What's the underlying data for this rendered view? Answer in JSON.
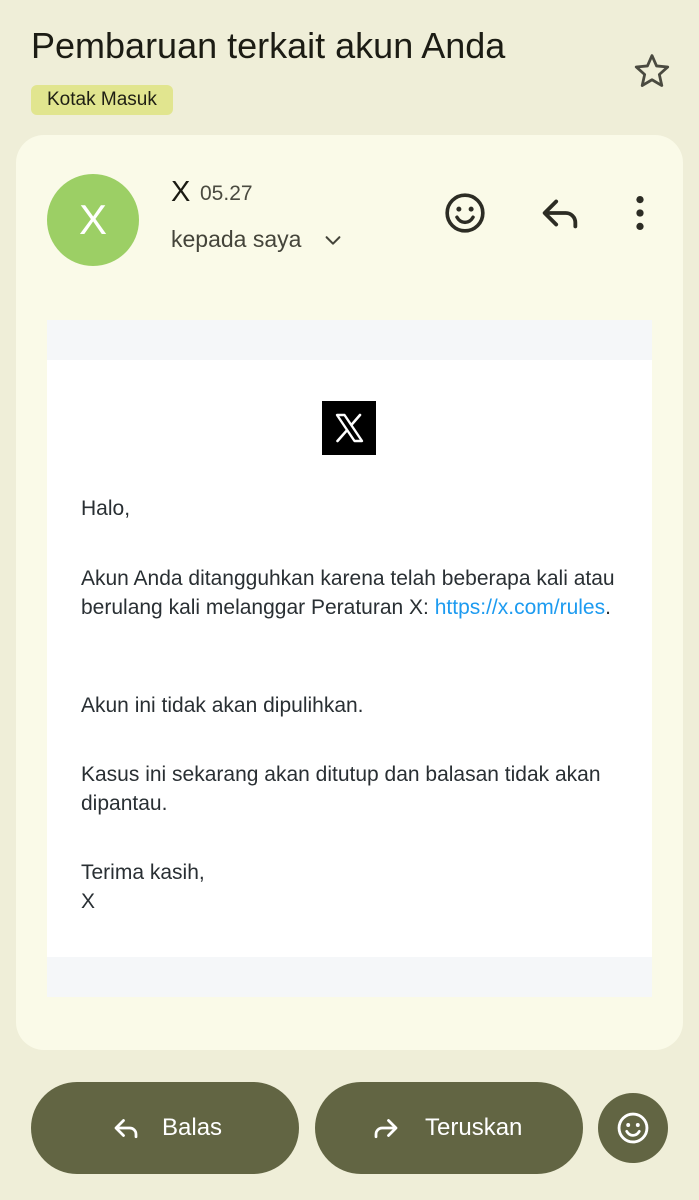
{
  "subject": "Pembaruan terkait akun Anda",
  "label": "Kotak Masuk",
  "sender": {
    "avatar_letter": "X",
    "name": "X",
    "time": "05.27",
    "recipient": "kepada saya"
  },
  "icons": {
    "star": "star-outline-icon",
    "react": "emoji-smile-icon",
    "reply": "reply-icon",
    "more": "more-vert-icon",
    "forward": "forward-icon"
  },
  "email": {
    "greeting": "Halo,",
    "paragraph1_text": "Akun Anda ditangguhkan karena telah beberapa kali atau berulang kali melanggar Peraturan X:",
    "paragraph1_link": "https://x.com/rules",
    "paragraph1_end": ".",
    "paragraph2": "Akun ini tidak akan dipulihkan.",
    "paragraph3": "Kasus ini sekarang akan ditutup dan balasan tidak akan dipantau.",
    "closing": "Terima kasih,",
    "signature": "X"
  },
  "actions": {
    "reply_label": "Balas",
    "forward_label": "Teruskan"
  },
  "colors": {
    "background": "#efeed8",
    "card": "#fafae8",
    "label_chip": "#e1e58f",
    "avatar": "#9ccf65",
    "action_buttons": "#626543",
    "link": "#1d9bf0"
  }
}
